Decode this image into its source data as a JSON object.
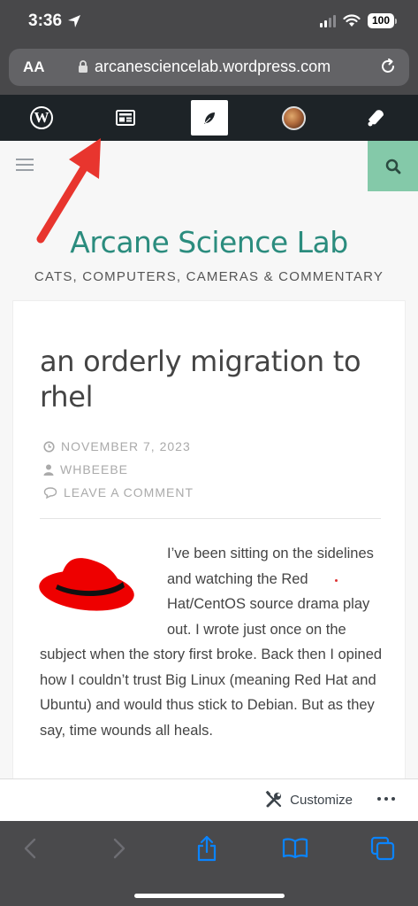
{
  "status": {
    "time": "3:36",
    "battery": "100"
  },
  "browser": {
    "text_size_label": "AA",
    "url": "arcanesciencelab.wordpress.com"
  },
  "admin_bar": {
    "items": [
      "wordpress-logo",
      "reader-icon",
      "write-feather-icon",
      "user-avatar",
      "notifications-bell-icon"
    ]
  },
  "site": {
    "title": "Arcane Science Lab",
    "description": "CATS, COMPUTERS, CAMERAS & COMMENTARY"
  },
  "post": {
    "title": "an orderly migration to rhel",
    "date": "NOVEMBER 7, 2023",
    "author": "WHBEEBE",
    "comments": "LEAVE A COMMENT",
    "body": "I’ve been sitting on the sidelines and watching the Red Hat/CentOS source drama play out. I wrote just once on the subject when the story first broke. Back then I opined how I couldn’t trust Big Linux (meaning Red Hat and Ubuntu) and would thus stick to Debian. But as they say, time wounds all heals."
  },
  "customize_bar": {
    "label": "Customize"
  },
  "colors": {
    "site_title": "#2b8c7e",
    "search_button": "#84c9a9",
    "admin_bar": "#1d2327",
    "ios_blue": "#0a84ff",
    "arrow": "#e8352e"
  }
}
